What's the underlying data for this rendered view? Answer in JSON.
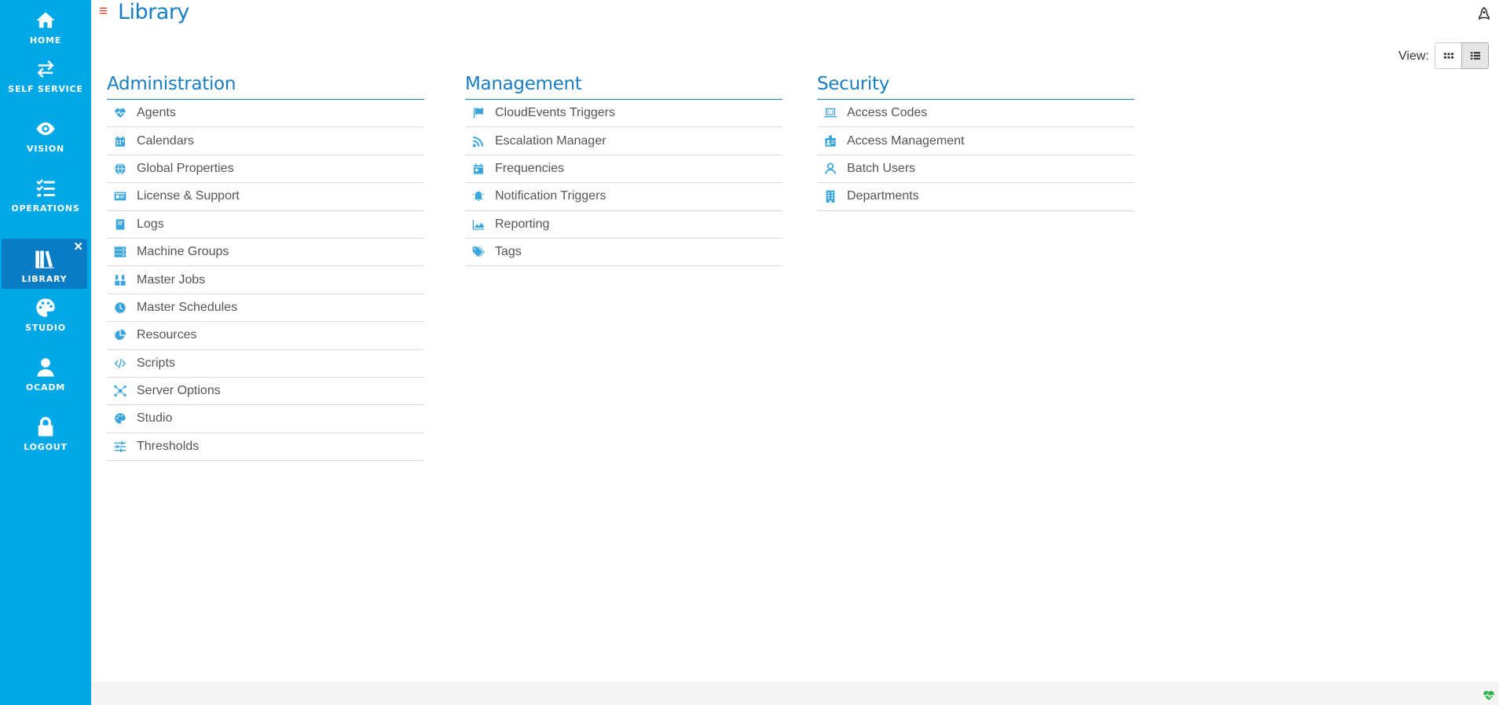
{
  "sidebar": {
    "items": [
      {
        "label": "HOME",
        "icon": "home-icon"
      },
      {
        "label": "SELF SERVICE",
        "icon": "swap-arrows-icon"
      },
      {
        "label": "VISION",
        "icon": "eye-icon"
      },
      {
        "label": "OPERATIONS",
        "icon": "checklist-icon"
      },
      {
        "label": "LIBRARY",
        "icon": "books-icon",
        "active": true,
        "close": "✕"
      },
      {
        "label": "STUDIO",
        "icon": "palette-icon"
      },
      {
        "label": "OCADM",
        "icon": "user-icon"
      },
      {
        "label": "LOGOUT",
        "icon": "lock-icon"
      }
    ]
  },
  "header": {
    "hamburger": "≡",
    "title": "Library"
  },
  "view": {
    "label": "View:",
    "selected": "list"
  },
  "columns": [
    {
      "title": "Administration",
      "items": [
        {
          "label": "Agents",
          "icon": "heartbeat-icon"
        },
        {
          "label": "Calendars",
          "icon": "calendar-icon"
        },
        {
          "label": "Global Properties",
          "icon": "globe-icon"
        },
        {
          "label": "License & Support",
          "icon": "id-card-icon"
        },
        {
          "label": "Logs",
          "icon": "book-icon"
        },
        {
          "label": "Machine Groups",
          "icon": "server-icon"
        },
        {
          "label": "Master Jobs",
          "icon": "cubes-icon"
        },
        {
          "label": "Master Schedules",
          "icon": "clock-icon"
        },
        {
          "label": "Resources",
          "icon": "pie-chart-icon"
        },
        {
          "label": "Scripts",
          "icon": "code-icon"
        },
        {
          "label": "Server Options",
          "icon": "network-icon"
        },
        {
          "label": "Studio",
          "icon": "palette-icon"
        },
        {
          "label": "Thresholds",
          "icon": "sliders-icon"
        }
      ]
    },
    {
      "title": "Management",
      "items": [
        {
          "label": "CloudEvents Triggers",
          "icon": "flag-icon"
        },
        {
          "label": "Escalation Manager",
          "icon": "rss-icon"
        },
        {
          "label": "Frequencies",
          "icon": "calendar-day-icon"
        },
        {
          "label": "Notification Triggers",
          "icon": "bell-ringing-icon"
        },
        {
          "label": "Reporting",
          "icon": "area-chart-icon"
        },
        {
          "label": "Tags",
          "icon": "tags-icon"
        }
      ]
    },
    {
      "title": "Security",
      "items": [
        {
          "label": "Access Codes",
          "icon": "laptop-code-icon"
        },
        {
          "label": "Access Management",
          "icon": "id-badge-icon"
        },
        {
          "label": "Batch Users",
          "icon": "user-outline-icon"
        },
        {
          "label": "Departments",
          "icon": "building-icon"
        }
      ]
    }
  ],
  "colors": {
    "sidebar": "#00a8e8",
    "active": "#0a7cc4",
    "title": "#1a7ec2",
    "icon": "#3ba6dd",
    "hamburger": "#e8412a",
    "heart": "#2db34a"
  }
}
